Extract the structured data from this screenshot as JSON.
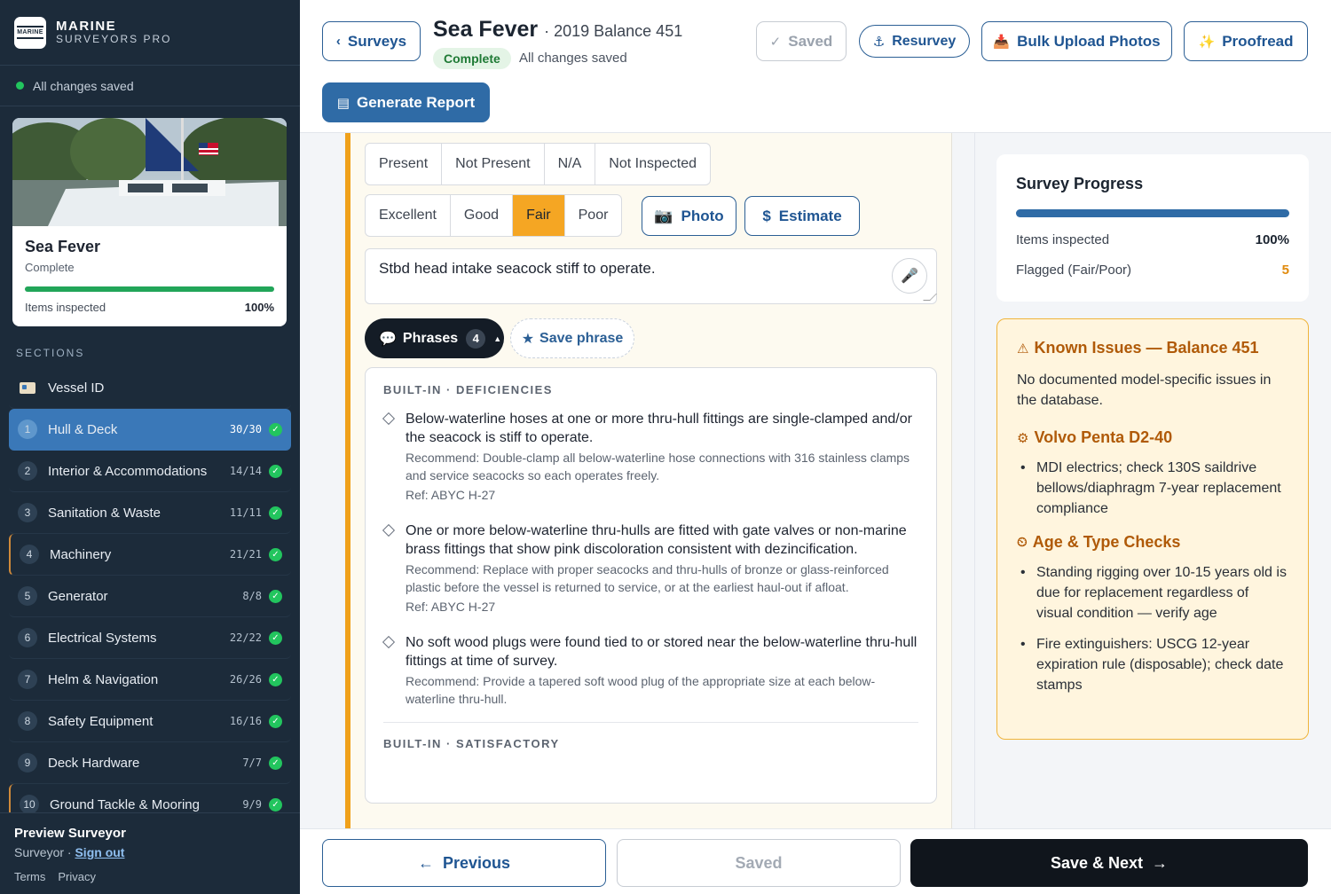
{
  "brand": {
    "line1": "MARINE",
    "line2": "SURVEYORS PRO",
    "logo_text": "MARINE"
  },
  "sidebar_status": "All changes saved",
  "vessel": {
    "name": "Sea Fever",
    "status": "Complete",
    "progress_label": "Items inspected",
    "progress_value": "100%",
    "progress_fraction": 1.0
  },
  "sections_heading": "SECTIONS",
  "vessel_id_label": "Vessel ID",
  "nav": [
    {
      "num": "1",
      "label": "Hull & Deck",
      "count": "30/30"
    },
    {
      "num": "2",
      "label": "Interior & Accommodations",
      "count": "14/14"
    },
    {
      "num": "3",
      "label": "Sanitation & Waste",
      "count": "11/11"
    },
    {
      "num": "4",
      "label": "Machinery",
      "count": "21/21"
    },
    {
      "num": "5",
      "label": "Generator",
      "count": "8/8"
    },
    {
      "num": "6",
      "label": "Electrical Systems",
      "count": "22/22"
    },
    {
      "num": "7",
      "label": "Helm & Navigation",
      "count": "26/26"
    },
    {
      "num": "8",
      "label": "Safety Equipment",
      "count": "16/16"
    },
    {
      "num": "9",
      "label": "Deck Hardware",
      "count": "7/7"
    },
    {
      "num": "10",
      "label": "Ground Tackle & Mooring",
      "count": "9/9"
    }
  ],
  "user": {
    "name": "Preview Surveyor",
    "role": "Surveyor ·",
    "sign_out": "Sign out",
    "terms": "Terms",
    "privacy": "Privacy"
  },
  "header": {
    "back": "Surveys",
    "title": "Sea Fever",
    "subtitle": "· 2019 Balance 451",
    "badge": "Complete",
    "changes": "All changes saved",
    "saved": "Saved",
    "resurvey": "Resurvey",
    "bulk_upload": "Bulk Upload Photos",
    "proofread": "Proofread",
    "generate": "Generate Report"
  },
  "item": {
    "presence": [
      "Present",
      "Not Present",
      "N/A",
      "Not Inspected"
    ],
    "condition": [
      "Excellent",
      "Good",
      "Fair",
      "Poor"
    ],
    "condition_selected": "Fair",
    "photo": "Photo",
    "estimate": "Estimate",
    "note": "Stbd head intake seacock stiff to operate.",
    "phrases_label": "Phrases",
    "phrases_count": "4",
    "save_phrase": "Save phrase"
  },
  "phrases": {
    "group1": "BUILT-IN · DEFICIENCIES",
    "items": [
      {
        "text": "Below-waterline hoses at one or more thru-hull fittings are single-clamped and/or the seacock is stiff to operate.",
        "rec": "Recommend: Double-clamp all below-waterline hose connections with 316 stainless clamps and service seacocks so each operates freely.",
        "ref": "Ref: ABYC H-27"
      },
      {
        "text": "One or more below-waterline thru-hulls are fitted with gate valves or non-marine brass fittings that show pink discoloration consistent with dezincification.",
        "rec": "Recommend: Replace with proper seacocks and thru-hulls of bronze or glass-reinforced plastic before the vessel is returned to service, or at the earliest haul-out if afloat.",
        "ref": "Ref: ABYC H-27"
      },
      {
        "text": "No soft wood plugs were found tied to or stored near the below-waterline thru-hull fittings at time of survey.",
        "rec": "Recommend: Provide a tapered soft wood plug of the appropriate size at each below-waterline thru-hull.",
        "ref": ""
      }
    ],
    "group2": "BUILT-IN · SATISFACTORY"
  },
  "footer": {
    "previous": "Previous",
    "saved": "Saved",
    "next": "Save & Next"
  },
  "progress": {
    "title": "Survey Progress",
    "inspected_label": "Items inspected",
    "inspected_value": "100%",
    "flagged_label": "Flagged (Fair/Poor)",
    "flagged_value": "5",
    "fraction": 1.0
  },
  "known_issues": {
    "title": "Known Issues — Balance 451",
    "none_text": "No documented model-specific issues in the database.",
    "engine_title": "Volvo Penta D2-40",
    "engine_items": [
      "MDI electrics; check 130S saildrive bellows/diaphragm 7-year replacement compliance"
    ],
    "age_title": "Age & Type Checks",
    "age_items": [
      "Standing rigging over 10-15 years old is due for replacement regardless of visual condition — verify age",
      "Fire extinguishers: USCG 12-year expiration rule (disposable); check date stamps"
    ]
  },
  "colors": {
    "sidebar": "#1c2b3a",
    "accent": "#2f6ba6",
    "fair": "#f5a623",
    "success": "#22c55e",
    "warning_bg": "#fff5de"
  }
}
